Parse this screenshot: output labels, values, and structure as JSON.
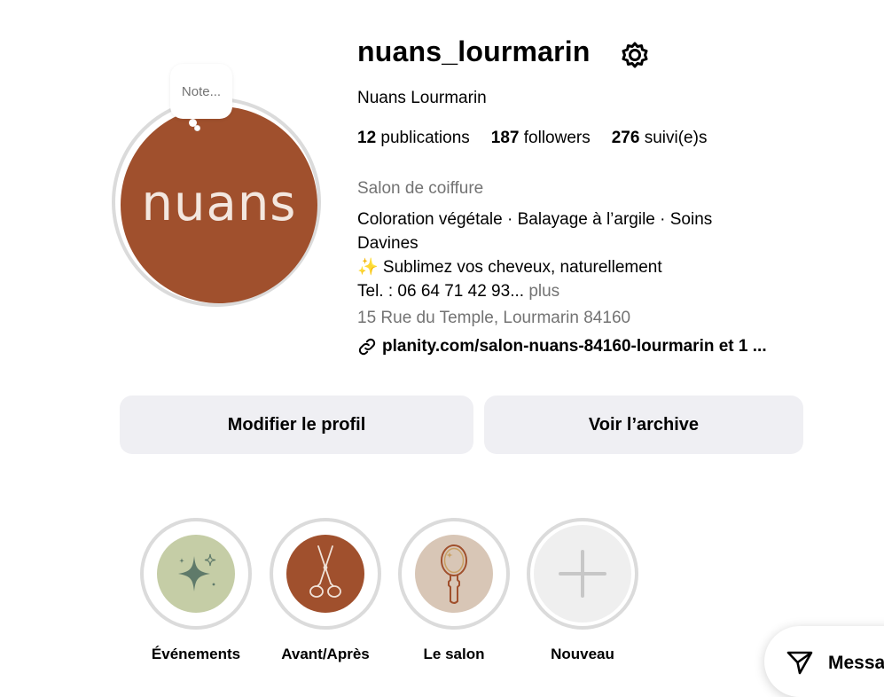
{
  "profile": {
    "username": "nuans_lourmarin",
    "full_name": "Nuans Lourmarin",
    "avatar_text": "nuans",
    "note_placeholder": "Note...",
    "stats": {
      "posts_count": "12",
      "posts_label": "publications",
      "followers_count": "187",
      "followers_label": "followers",
      "following_count": "276",
      "following_label": "suivi(e)s"
    },
    "category": "Salon de coiffure",
    "bio_line1": "Coloration végétale · Balayage à l’argile · Soins Davines",
    "bio_line2": "✨ Sublimez vos cheveux, naturellement",
    "bio_line3": "Tel. : 06 64 71 42 93...",
    "bio_more": "plus",
    "address": "15 Rue du Temple, Lourmarin 84160",
    "link": "planity.com/salon-nuans-84160-lourmarin et 1 ..."
  },
  "actions": {
    "edit_profile": "Modifier le profil",
    "view_archive": "Voir l’archive"
  },
  "highlights": [
    {
      "label": "Événements",
      "color": "#c5cda6",
      "icon": "sparkles-icon"
    },
    {
      "label": "Avant/Après",
      "color": "#a0502d",
      "icon": "scissors-icon"
    },
    {
      "label": "Le salon",
      "color": "#d8c6b6",
      "icon": "hand-mirror-icon"
    },
    {
      "label": "Nouveau",
      "color": "#efefef",
      "icon": "plus-icon"
    }
  ],
  "messages": {
    "label": "Messa"
  },
  "colors": {
    "brand": "#a0502d",
    "button_bg": "#efeff3",
    "muted_text": "#737373"
  }
}
